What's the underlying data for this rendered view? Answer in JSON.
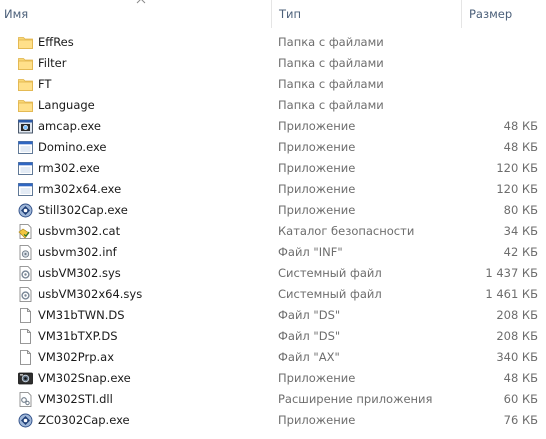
{
  "columns": {
    "name": "Имя",
    "type": "Тип",
    "size": "Размер"
  },
  "files": [
    {
      "name": "EffRes",
      "type": "Папка с файлами",
      "size": "",
      "icon": "folder-icon"
    },
    {
      "name": "Filter",
      "type": "Папка с файлами",
      "size": "",
      "icon": "folder-icon"
    },
    {
      "name": "FT",
      "type": "Папка с файлами",
      "size": "",
      "icon": "folder-icon"
    },
    {
      "name": "Language",
      "type": "Папка с файлами",
      "size": "",
      "icon": "folder-icon"
    },
    {
      "name": "amcap.exe",
      "type": "Приложение",
      "size": "48 КБ",
      "icon": "camera-app-icon"
    },
    {
      "name": "Domino.exe",
      "type": "Приложение",
      "size": "48 КБ",
      "icon": "window-app-icon"
    },
    {
      "name": "rm302.exe",
      "type": "Приложение",
      "size": "120 КБ",
      "icon": "window-app-icon"
    },
    {
      "name": "rm302x64.exe",
      "type": "Приложение",
      "size": "120 КБ",
      "icon": "window-app-icon"
    },
    {
      "name": "Still302Cap.exe",
      "type": "Приложение",
      "size": "80 КБ",
      "icon": "still-capture-icon"
    },
    {
      "name": "usbvm302.cat",
      "type": "Каталог безопасности",
      "size": "34 КБ",
      "icon": "security-catalog-icon"
    },
    {
      "name": "usbvm302.inf",
      "type": "Файл \"INF\"",
      "size": "42 КБ",
      "icon": "setup-info-icon"
    },
    {
      "name": "usbVM302.sys",
      "type": "Системный файл",
      "size": "1 437 КБ",
      "icon": "system-file-icon"
    },
    {
      "name": "usbVM302x64.sys",
      "type": "Системный файл",
      "size": "1 461 КБ",
      "icon": "system-file-icon"
    },
    {
      "name": "VM31bTWN.DS",
      "type": "Файл \"DS\"",
      "size": "208 КБ",
      "icon": "blank-file-icon"
    },
    {
      "name": "VM31bTXP.DS",
      "type": "Файл \"DS\"",
      "size": "208 КБ",
      "icon": "blank-file-icon"
    },
    {
      "name": "VM302Prp.ax",
      "type": "Файл \"AX\"",
      "size": "340 КБ",
      "icon": "blank-file-icon"
    },
    {
      "name": "VM302Snap.exe",
      "type": "Приложение",
      "size": "48 КБ",
      "icon": "snap-app-icon"
    },
    {
      "name": "VM302STI.dll",
      "type": "Расширение приложения",
      "size": "60 КБ",
      "icon": "dll-file-icon"
    },
    {
      "name": "ZC0302Cap.exe",
      "type": "Приложение",
      "size": "76 КБ",
      "icon": "capture-app-icon"
    }
  ]
}
